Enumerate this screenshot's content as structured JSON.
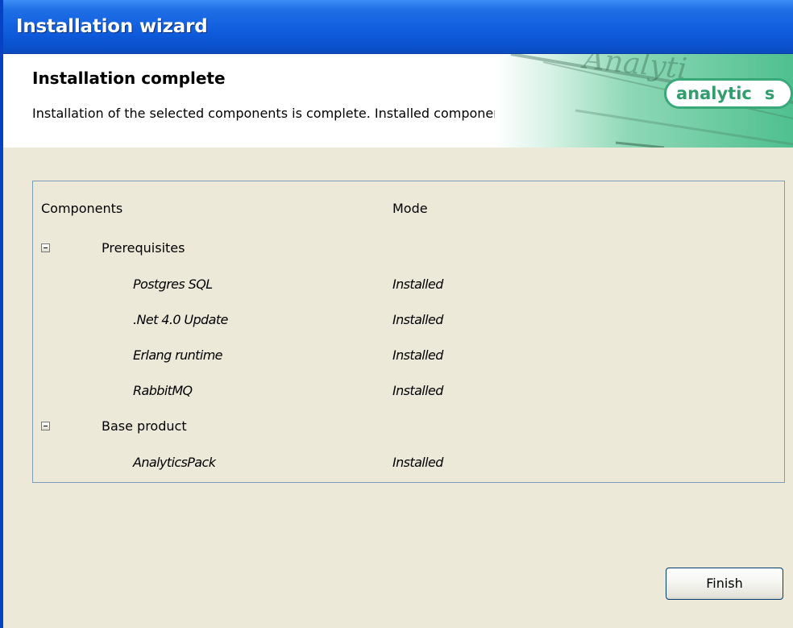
{
  "window": {
    "title": "Installation wizard"
  },
  "header": {
    "heading": "Installation complete",
    "description": "Installation of the selected components is complete. Installed components are:"
  },
  "banner": {
    "logo_text": "analytic",
    "logo_suffix": "s",
    "background_text": "Analyti",
    "accent_color": "#3aa97a"
  },
  "components": {
    "column_headers": {
      "components": "Components",
      "mode": "Mode"
    },
    "groups": [
      {
        "label": "Prerequisites",
        "expander_icon": "collapse-minus-icon",
        "items": [
          {
            "name": "Postgres SQL",
            "mode": "Installed"
          },
          {
            "name": ".Net 4.0 Update",
            "mode": "Installed"
          },
          {
            "name": "Erlang runtime",
            "mode": "Installed"
          },
          {
            "name": "RabbitMQ",
            "mode": "Installed"
          }
        ]
      },
      {
        "label": "Base product",
        "expander_icon": "collapse-minus-icon",
        "items": [
          {
            "name": "AnalyticsPack",
            "mode": "Installed"
          }
        ]
      }
    ]
  },
  "buttons": {
    "finish_label": "Finish"
  }
}
